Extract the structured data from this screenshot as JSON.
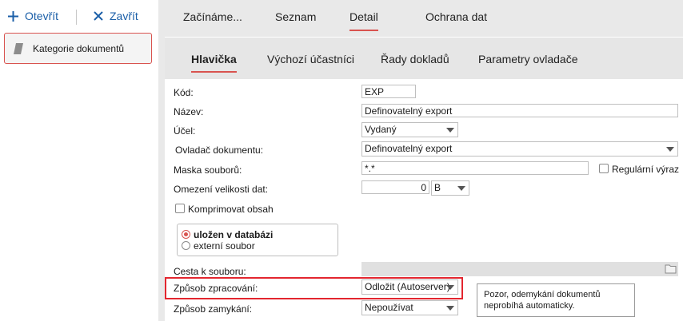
{
  "toolbar": {
    "open_label": "Otevřít",
    "close_label": "Zavřít"
  },
  "left_panel": {
    "items": [
      {
        "label": "Kategorie dokumentů"
      }
    ]
  },
  "tabs_main": [
    {
      "label": "Začínáme..."
    },
    {
      "label": "Seznam"
    },
    {
      "label": "Detail",
      "active": true
    },
    {
      "label": "Ochrana dat"
    }
  ],
  "tabs_sub": [
    {
      "label": "Hlavička",
      "active": true
    },
    {
      "label": "Výchozí účastníci"
    },
    {
      "label": "Řady dokladů"
    },
    {
      "label": "Parametry ovladače"
    }
  ],
  "form": {
    "kod": {
      "label": "Kód:",
      "value": "EXP"
    },
    "nazev": {
      "label": "Název:",
      "value": "Definovatelný export"
    },
    "ucel": {
      "label": "Účel:",
      "value": "Vydaný"
    },
    "ovladac": {
      "label": "Ovladač dokumentu:",
      "value": "Definovatelný export"
    },
    "maska": {
      "label": "Maska souborů:",
      "value": "*.*"
    },
    "regex": {
      "label": "Regulární výraz",
      "checked": false
    },
    "omezeni": {
      "label": "Omezení velikosti dat:",
      "value": "0",
      "unit": "B"
    },
    "komprimovat": {
      "label": "Komprimovat obsah",
      "checked": false
    },
    "storage": {
      "option_db": "uložen v databázi",
      "option_file": "externí soubor",
      "selected": "db"
    },
    "cesta": {
      "label": "Cesta k souboru:",
      "value": ""
    },
    "zpusob_zpracovani": {
      "label": "Způsob zpracování:",
      "value": "Odložit (Autoserver)"
    },
    "zpusob_zamykani": {
      "label": "Způsob zamykání:",
      "value": "Nepoužívat"
    },
    "note": "Pozor, odemykání dokumentů neprobíhá automaticky."
  },
  "colors": {
    "accent": "#d9534f",
    "link": "#1b5fa8",
    "highlight": "#e3262f"
  }
}
